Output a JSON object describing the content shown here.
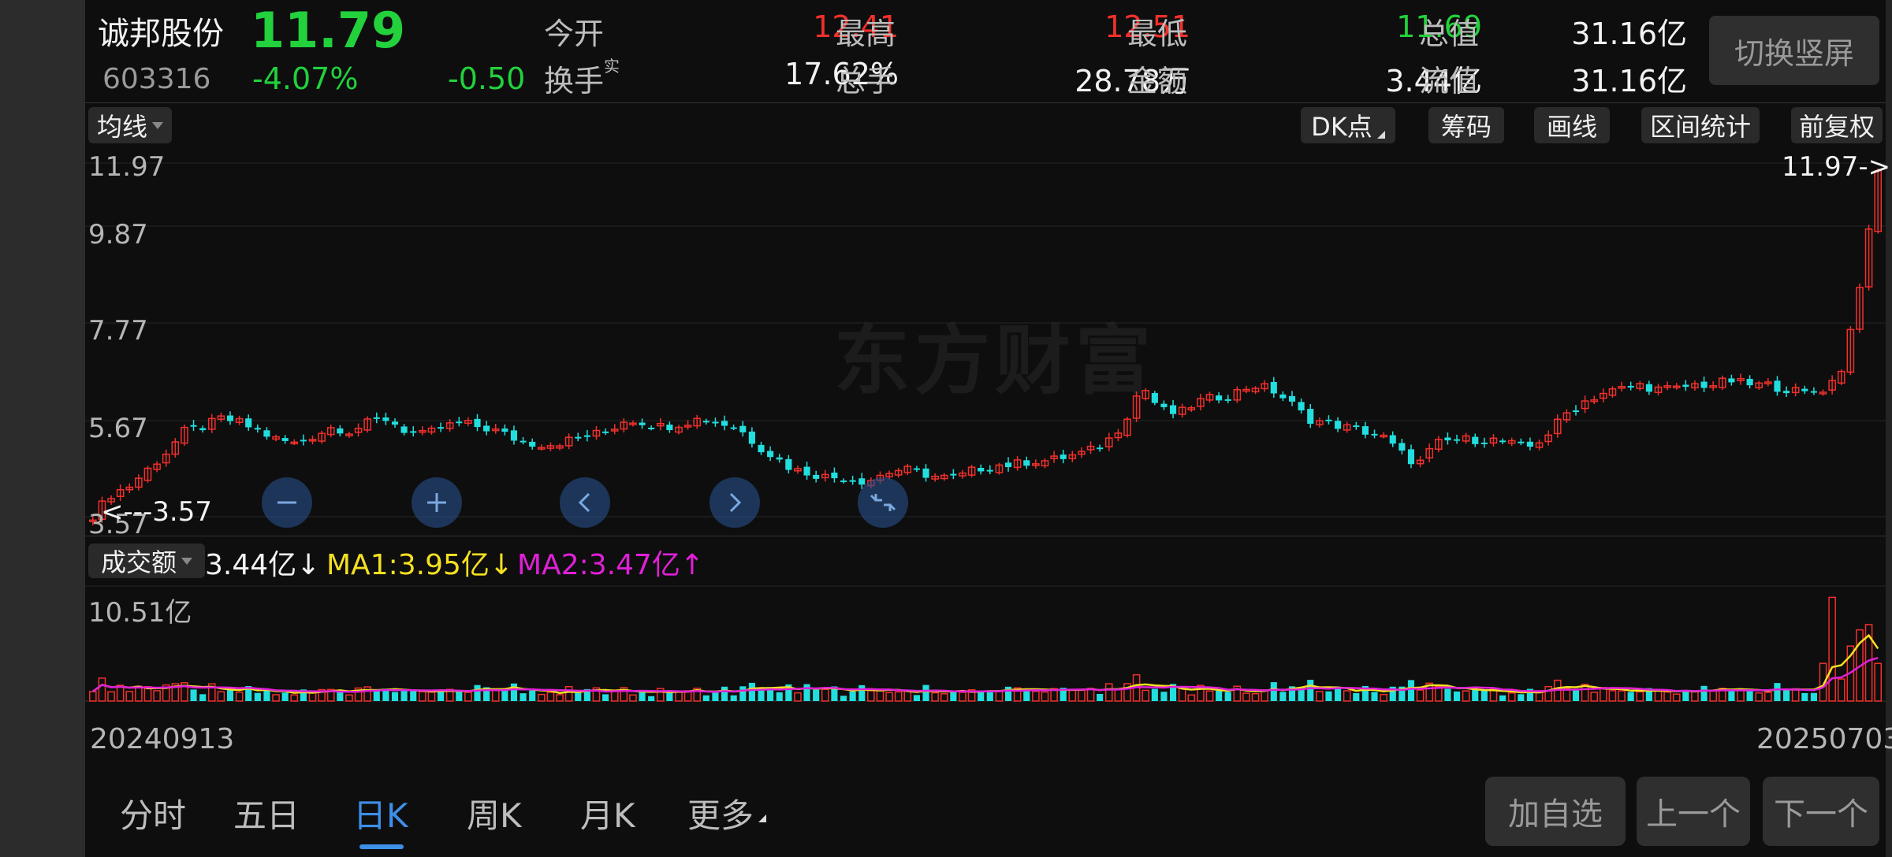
{
  "stock": {
    "name": "诚邦股份",
    "price": "11.79",
    "code": "603316",
    "pct": "-4.07%",
    "change": "-0.50"
  },
  "quote": {
    "open_label": "今开",
    "open": "12.41",
    "high_label": "最高",
    "high": "12.51",
    "low_label": "最低",
    "low": "11.69",
    "mktcap_label": "总值",
    "mktcap": "31.16亿",
    "turnover_label": "换手",
    "turnover_sup": "实",
    "turnover": "17.62%",
    "volume_label": "总手",
    "volume": "28.78万",
    "amount_label": "金额",
    "amount": "3.44亿",
    "float_label": "流值",
    "float": "31.16亿"
  },
  "switch_label": "切换竖屏",
  "toolbar": {
    "ma": "均线",
    "dk": "DK点",
    "chips": "筹码",
    "draw": "画线",
    "interval": "区间统计",
    "adjust": "前复权"
  },
  "watermark": "东方财富",
  "price_axis": [
    "11.97",
    "9.87",
    "7.77",
    "5.67",
    "3.57"
  ],
  "markers": {
    "high": "11.97->",
    "low": "<---3.57"
  },
  "volume_panel": {
    "title": "成交额",
    "value": "3.44亿",
    "value_arrow": "↓",
    "ma1": "MA1:3.95亿",
    "ma1_arrow": "↓",
    "ma2": "MA2:3.47亿",
    "ma2_arrow": "↑",
    "max_label": "10.51亿"
  },
  "dates": {
    "start": "20240913",
    "end": "20250703"
  },
  "tabs": [
    "分时",
    "五日",
    "日K",
    "周K",
    "月K",
    "更多"
  ],
  "active_tab": "日K",
  "buttons": {
    "add": "加自选",
    "prev": "上一个",
    "next": "下一个"
  },
  "colors": {
    "up": "#f0302c",
    "down": "#22dede",
    "price_down": "#22d13c",
    "ma1": "#f5e021",
    "ma2": "#e020d8",
    "active_tab": "#3d8fe8"
  },
  "chart_data": {
    "type": "candlestick",
    "ylim": [
      3.57,
      11.97
    ],
    "period": [
      "20240913",
      "20250703"
    ],
    "close": [
      3.6,
      4.1,
      4.3,
      4.7,
      5.1,
      5.6,
      5.7,
      5.9,
      5.8,
      5.6,
      5.4,
      5.3,
      5.5,
      5.7,
      5.6,
      5.8,
      5.9,
      5.6,
      5.5,
      5.7,
      5.8,
      5.7,
      5.6,
      5.4,
      5.3,
      5.3,
      5.4,
      5.5,
      5.6,
      5.9,
      5.8,
      5.7,
      5.8,
      5.9,
      5.8,
      5.7,
      5.3,
      5.0,
      4.7,
      4.6,
      4.5,
      4.5,
      4.4,
      4.6,
      4.7,
      4.6,
      4.5,
      4.5,
      4.7,
      4.8,
      4.8,
      4.9,
      4.9,
      5.0,
      5.1,
      5.3,
      5.8,
      6.7,
      6.1,
      6.0,
      6.3,
      6.4,
      6.5,
      6.7,
      6.6,
      6.3,
      5.9,
      5.8,
      5.7,
      5.6,
      5.5,
      5.1,
      4.8,
      5.3,
      5.4,
      5.4,
      5.4,
      5.3,
      5.2,
      5.5,
      6.0,
      6.3,
      6.5,
      6.6,
      6.7,
      6.6,
      6.6,
      6.7,
      6.7,
      6.8,
      6.7,
      6.7,
      6.6,
      6.5,
      6.6,
      7.0,
      9.0,
      11.79
    ],
    "volume_ylim": [
      0,
      10.51
    ],
    "volume_unit": "亿",
    "volume_value": 3.44,
    "ma1": 3.95,
    "ma2": 3.47
  }
}
